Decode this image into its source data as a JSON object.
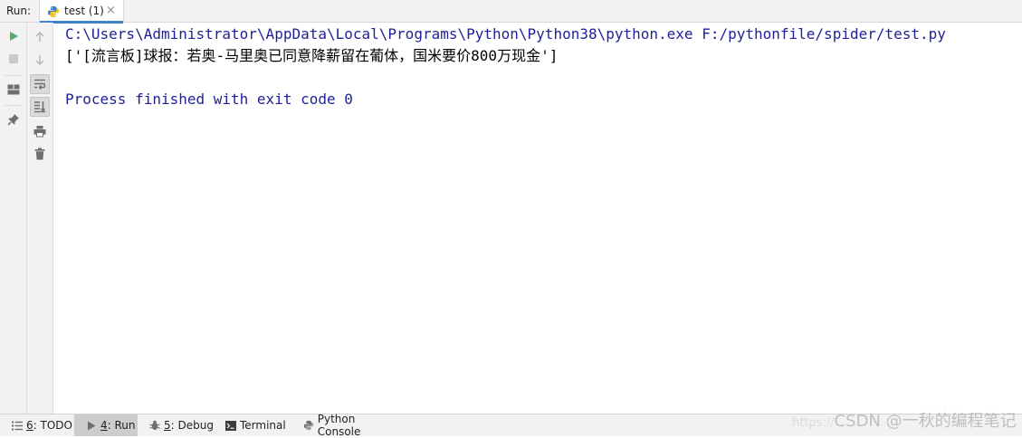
{
  "top": {
    "run_label": "Run:",
    "tab": {
      "label": "test (1)",
      "close": "×"
    }
  },
  "console": {
    "lines": [
      {
        "text": "C:\\Users\\Administrator\\AppData\\Local\\Programs\\Python\\Python38\\python.exe F:/pythonfile/spider/test.py",
        "kind": "command"
      },
      {
        "text": "['[流言板]球报：若奥-马里奥已同意降薪留在葡体，国米要价800万现金']",
        "kind": "output"
      },
      {
        "text": "",
        "kind": "blank"
      },
      {
        "text": "Process finished with exit code 0",
        "kind": "command"
      }
    ]
  },
  "bottom": {
    "items": [
      {
        "num": "6",
        "label": ": TODO",
        "icon": "list-icon",
        "active": false
      },
      {
        "num": "4",
        "label": ": Run",
        "icon": "run-icon",
        "active": true
      },
      {
        "num": "5",
        "label": ": Debug",
        "icon": "bug-icon",
        "active": false
      },
      {
        "num": "",
        "label": "Terminal",
        "icon": "terminal-icon",
        "active": false
      },
      {
        "num": "",
        "label": "Python Console",
        "icon": "python-icon",
        "active": false
      }
    ]
  },
  "watermark": {
    "faint_prefix": "https://",
    "text": "CSDN @一秋的编程笔记"
  },
  "colors": {
    "command_text": "#1f1f99",
    "run_green": "#59a869",
    "tab_underline": "#4083c9"
  }
}
